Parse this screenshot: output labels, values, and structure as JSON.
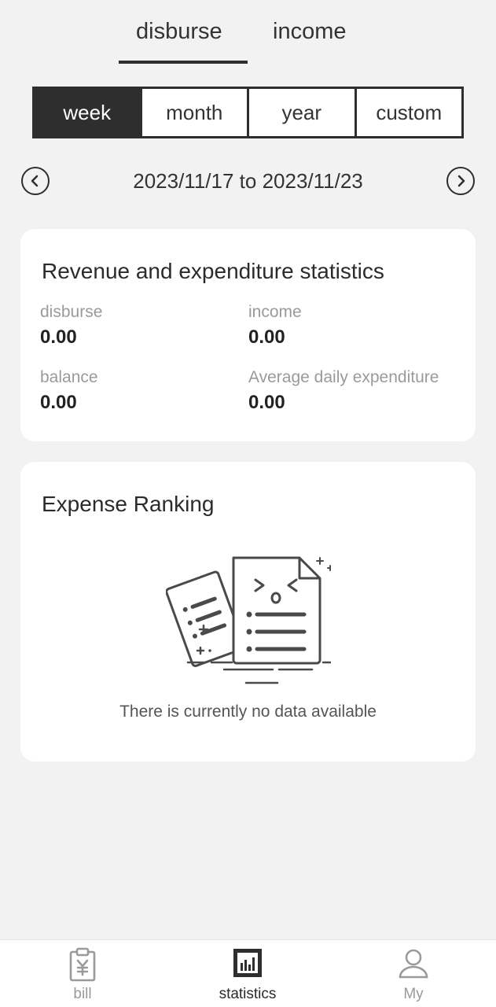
{
  "top_tabs": [
    {
      "label": "disburse",
      "active": true
    },
    {
      "label": "income",
      "active": false
    }
  ],
  "period_segments": [
    {
      "label": "week",
      "active": true
    },
    {
      "label": "month",
      "active": false
    },
    {
      "label": "year",
      "active": false
    },
    {
      "label": "custom",
      "active": false
    }
  ],
  "date_nav": {
    "range": "2023/11/17 to 2023/11/23",
    "prev_icon": "chevron-left-circle-icon",
    "next_icon": "chevron-right-circle-icon"
  },
  "stats_card": {
    "title": "Revenue and expenditure statistics",
    "items": [
      {
        "label": "disburse",
        "value": "0.00"
      },
      {
        "label": "income",
        "value": "0.00"
      },
      {
        "label": "balance",
        "value": "0.00"
      },
      {
        "label": "Average daily expenditure",
        "value": "0.00"
      }
    ]
  },
  "ranking_card": {
    "title": "Expense Ranking",
    "empty_icon": "empty-documents-icon",
    "empty_text": "There is currently no data available"
  },
  "bottom_nav": [
    {
      "label": "bill",
      "icon": "clipboard-yen-icon",
      "active": false
    },
    {
      "label": "statistics",
      "icon": "bar-chart-icon",
      "active": true
    },
    {
      "label": "My",
      "icon": "user-icon",
      "active": false
    }
  ],
  "colors": {
    "background": "#f2f2f2",
    "accent": "#2e2e2e",
    "card": "#ffffff",
    "muted_text": "#9a9a9a"
  }
}
